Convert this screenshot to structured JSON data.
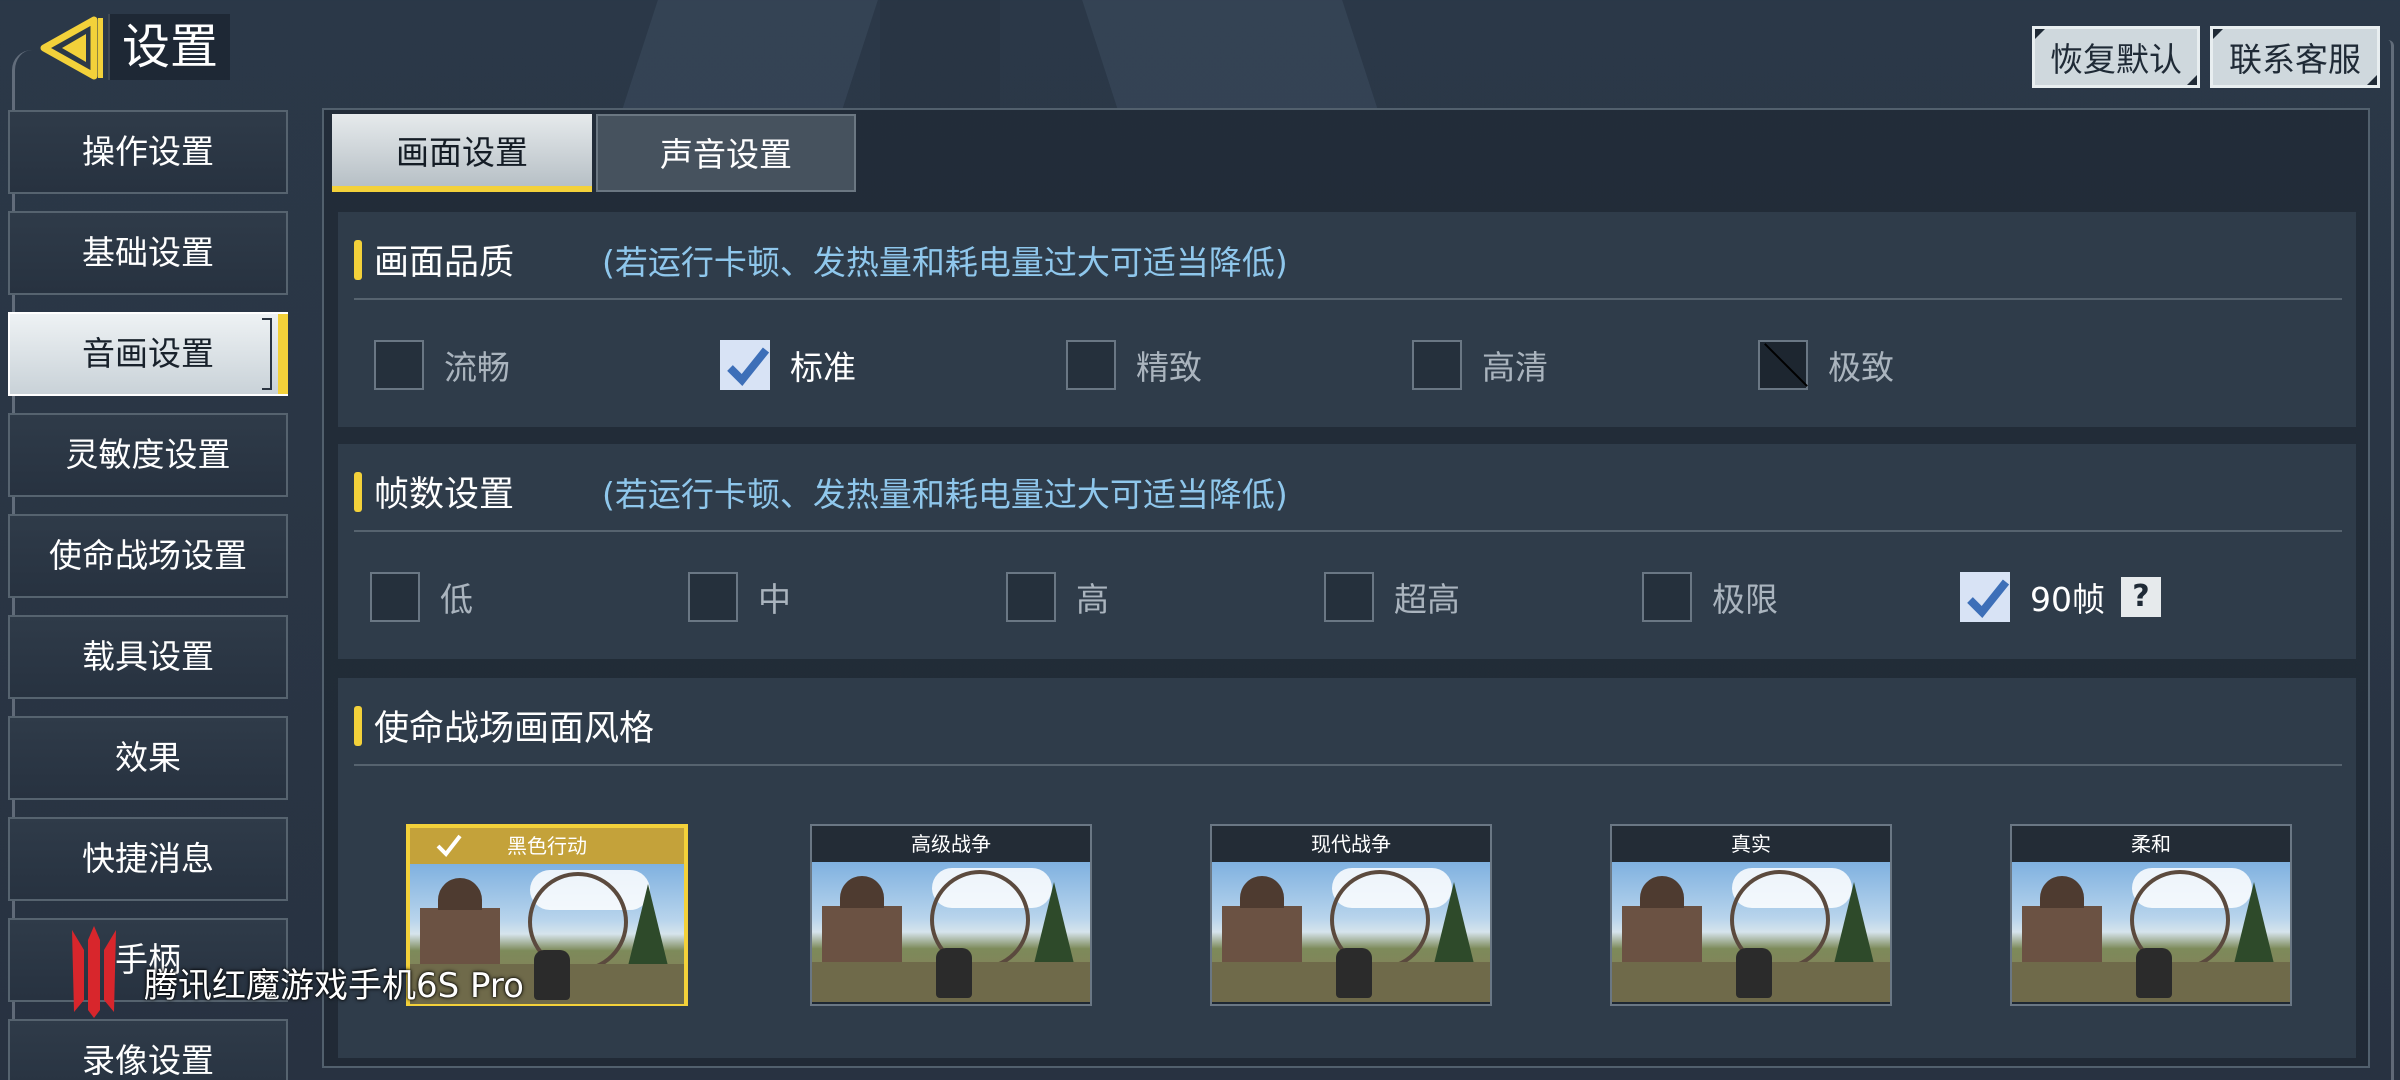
{
  "header": {
    "title": "设置",
    "reset_label": "恢复默认",
    "support_label": "联系客服"
  },
  "sidebar": {
    "items": [
      {
        "label": "操作设置",
        "active": false
      },
      {
        "label": "基础设置",
        "active": false
      },
      {
        "label": "音画设置",
        "active": true
      },
      {
        "label": "灵敏度设置",
        "active": false
      },
      {
        "label": "使命战场设置",
        "active": false
      },
      {
        "label": "载具设置",
        "active": false
      },
      {
        "label": "效果",
        "active": false
      },
      {
        "label": "快捷消息",
        "active": false
      },
      {
        "label": "手柄",
        "active": false
      },
      {
        "label": "录像设置",
        "active": false
      }
    ]
  },
  "tabs": [
    {
      "label": "画面设置",
      "active": true
    },
    {
      "label": "声音设置",
      "active": false
    }
  ],
  "quality": {
    "title": "画面品质",
    "hint": "(若运行卡顿、发热量和耗电量过大可适当降低)",
    "options": [
      {
        "label": "流畅",
        "state": "unchecked"
      },
      {
        "label": "标准",
        "state": "checked"
      },
      {
        "label": "精致",
        "state": "unchecked"
      },
      {
        "label": "高清",
        "state": "unchecked"
      },
      {
        "label": "极致",
        "state": "disabled"
      }
    ]
  },
  "fps": {
    "title": "帧数设置",
    "hint": "(若运行卡顿、发热量和耗电量过大可适当降低)",
    "options": [
      {
        "label": "低",
        "state": "unchecked"
      },
      {
        "label": "中",
        "state": "unchecked"
      },
      {
        "label": "高",
        "state": "unchecked"
      },
      {
        "label": "超高",
        "state": "unchecked"
      },
      {
        "label": "极限",
        "state": "unchecked"
      },
      {
        "label": "90帧",
        "state": "checked"
      }
    ],
    "help_label": "?"
  },
  "style": {
    "title": "使命战场画面风格",
    "options": [
      {
        "label": "黑色行动",
        "selected": true
      },
      {
        "label": "高级战争",
        "selected": false
      },
      {
        "label": "现代战争",
        "selected": false
      },
      {
        "label": "真实",
        "selected": false
      },
      {
        "label": "柔和",
        "selected": false
      }
    ]
  },
  "watermark": {
    "text": "腾讯红魔游戏手机6S Pro"
  },
  "colors": {
    "accent": "#f3d13a",
    "hint": "#8fc7ec",
    "checked_box": "#d8e3f5",
    "panel": "#2f3c4a"
  }
}
